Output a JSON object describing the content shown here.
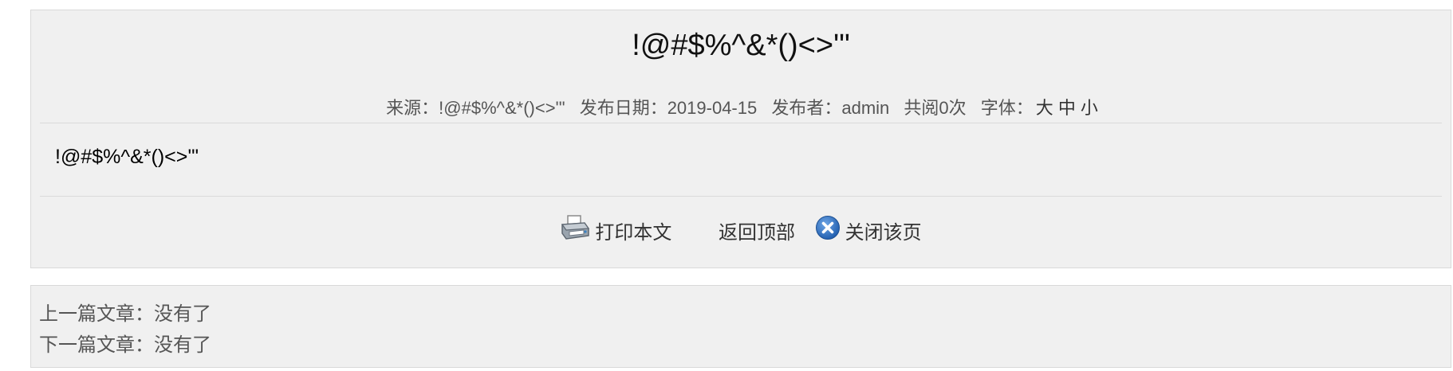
{
  "article": {
    "title": "!@#$%^&*()<>'\"",
    "meta": {
      "source": "来源：!@#$%^&*()<>'\"",
      "publish_date": "发布日期：2019-04-15",
      "publisher": "发布者：admin",
      "views": "共阅0次",
      "font_label": "字体：",
      "font_large": "大",
      "font_medium": "中",
      "font_small": "小"
    },
    "content": "!@#$%^&*()<>'\""
  },
  "actions": {
    "print_label": "打印本文",
    "back_to_top_label": "返回顶部",
    "close_label": "关闭该页",
    "print_icon": "printer-icon",
    "close_icon": "close-circle-icon"
  },
  "navigation": {
    "prev": "上一篇文章：没有了",
    "next": "下一篇文章：没有了"
  }
}
